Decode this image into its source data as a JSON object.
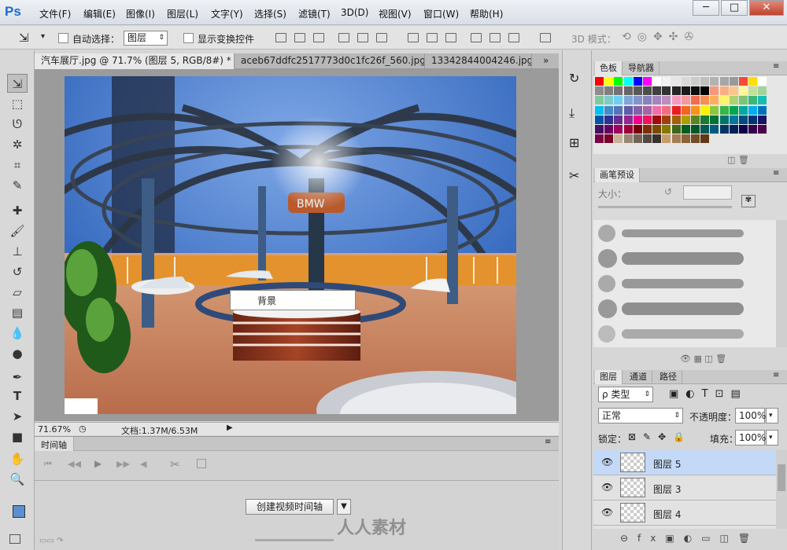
{
  "app": {
    "logo": "Ps"
  },
  "menu": [
    "文件(F)",
    "编辑(E)",
    "图像(I)",
    "图层(L)",
    "文字(Y)",
    "选择(S)",
    "滤镜(T)",
    "3D(D)",
    "视图(V)",
    "窗口(W)",
    "帮助(H)"
  ],
  "window_controls": {
    "min": "─",
    "max": "□",
    "close": "✕"
  },
  "options": {
    "auto_select_label": "自动选择：",
    "auto_select_value": "图层",
    "show_transform_label": "显示变换控件",
    "mode_3d_label": "3D 模式："
  },
  "tabs": [
    {
      "label": "汽车展厅.jpg @ 71.7% (图层 5, RGB/8#) *",
      "close": "×"
    },
    {
      "label": "aceb67ddfc2517773d0c1fc26f_560.jpg",
      "close": "×"
    },
    {
      "label": "13342844004246.jpg",
      "close": ""
    }
  ],
  "canvas": {
    "context_menu_item": "背景",
    "booth_sign": "BMW"
  },
  "status": {
    "zoom": "71.67%",
    "doc": "文档:1.37M/6.53M"
  },
  "timeline": {
    "title": "时间轴",
    "create_button": "创建视频时间轴"
  },
  "swatches_panel": {
    "tabs": [
      "色板",
      "导航器"
    ],
    "colors": [
      "#ff0000",
      "#ffff00",
      "#00ff00",
      "#00ffff",
      "#0000ff",
      "#ff00ff",
      "#ffffff",
      "#f2f2f2",
      "#e6e6e6",
      "#d9d9d9",
      "#cccccc",
      "#bfbfbf",
      "#b3b3b3",
      "#a6a6a6",
      "#999999",
      "#f44b3a",
      "#ffde00",
      "#ffffff",
      "#8c8c8c",
      "#808080",
      "#737373",
      "#666666",
      "#595959",
      "#4d4d4d",
      "#404040",
      "#333333",
      "#262626",
      "#1a1a1a",
      "#0d0d0d",
      "#000000",
      "#f7977a",
      "#fbad82",
      "#fdc68a",
      "#fff79a",
      "#c4df9b",
      "#a3d39c",
      "#82ca9d",
      "#7bcdc8",
      "#6ecff6",
      "#7ea7d8",
      "#8493ca",
      "#8882be",
      "#a187be",
      "#bc8dbf",
      "#f49ac2",
      "#f6989d",
      "#f26c4f",
      "#f68e55",
      "#fbaf5c",
      "#fff467",
      "#acd372",
      "#7cc576",
      "#3bb878",
      "#1abbb4",
      "#00bff3",
      "#438cca",
      "#5574b9",
      "#605ca8",
      "#855fa8",
      "#a763a8",
      "#f06ea9",
      "#f26d7d",
      "#ed1c24",
      "#f26522",
      "#f7941d",
      "#fff200",
      "#8dc73f",
      "#39b54a",
      "#00a651",
      "#00a99d",
      "#00aeef",
      "#0072bc",
      "#0054a6",
      "#2e3192",
      "#662d91",
      "#92278f",
      "#ec008c",
      "#ed145b",
      "#9e0b0f",
      "#a0410d",
      "#a36209",
      "#aba000",
      "#598527",
      "#197b30",
      "#007236",
      "#00746b",
      "#0076a3",
      "#004b80",
      "#003471",
      "#1b1464",
      "#440e62",
      "#630460",
      "#9e005d",
      "#9e0039",
      "#790000",
      "#7b2e00",
      "#7d4900",
      "#827b00",
      "#406618",
      "#005e20",
      "#005826",
      "#005952",
      "#005b7f",
      "#003663",
      "#002157",
      "#0d004c",
      "#32004b",
      "#4b0049",
      "#7b0046",
      "#7a0026",
      "#c7b299",
      "#998675",
      "#736357",
      "#534741",
      "#37302d",
      "#c69c6d",
      "#a67c52",
      "#8c6239",
      "#754c24",
      "#603813"
    ]
  },
  "brush_panel": {
    "title": "画笔预设",
    "size_label": "大小："
  },
  "layers_panel": {
    "tabs": [
      "图层",
      "通道",
      "路径"
    ],
    "filter_kind": "ρ 类型",
    "blend_mode": "正常",
    "opacity_label": "不透明度：",
    "opacity_value": "100%",
    "lock_label": "锁定：",
    "fill_label": "填充：",
    "fill_value": "100%",
    "layers": [
      {
        "name": "图层 5",
        "selected": true
      },
      {
        "name": "图层 3",
        "selected": false
      },
      {
        "name": "图层 4",
        "selected": false
      }
    ]
  },
  "watermark": "人人素材"
}
